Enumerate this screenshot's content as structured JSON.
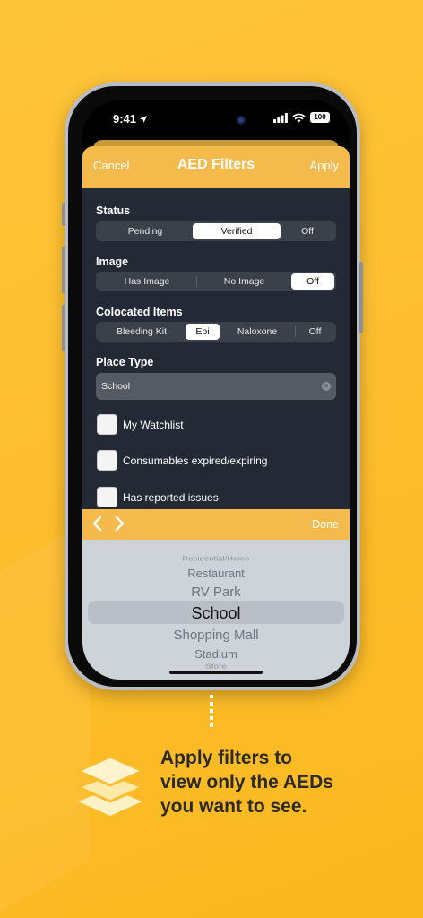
{
  "status_bar": {
    "time": "9:41",
    "battery": "100"
  },
  "header": {
    "cancel": "Cancel",
    "title": "AED Filters",
    "apply": "Apply"
  },
  "filters": {
    "status": {
      "label": "Status",
      "options": [
        "Pending",
        "Verified",
        "Off"
      ],
      "selected": "Verified"
    },
    "image": {
      "label": "Image",
      "options": [
        "Has Image",
        "No Image",
        "Off"
      ],
      "selected": "Off"
    },
    "colocated": {
      "label": "Colocated Items",
      "options": [
        "Bleeding Kit",
        "Epi",
        "Naloxone",
        "Off"
      ],
      "selected": "Epi"
    },
    "place_type": {
      "label": "Place Type",
      "value": "School"
    }
  },
  "checkboxes": [
    {
      "label": "My Watchlist",
      "checked": false
    },
    {
      "label": "Consumables expired/expiring",
      "checked": false
    },
    {
      "label": "Has reported issues",
      "checked": false
    }
  ],
  "toolbar": {
    "done": "Done"
  },
  "picker": {
    "items": [
      "Residential/Home",
      "Restaurant",
      "RV Park",
      "School",
      "Shopping Mall",
      "Stadium",
      "Store"
    ],
    "selected": "School"
  },
  "promo": {
    "line1": "Apply filters to",
    "line2": "view only the AEDs",
    "line3": "you want to see."
  },
  "colors": {
    "background": "#fcbd2c",
    "accent": "#f4bb4c",
    "panel": "#232a36"
  }
}
